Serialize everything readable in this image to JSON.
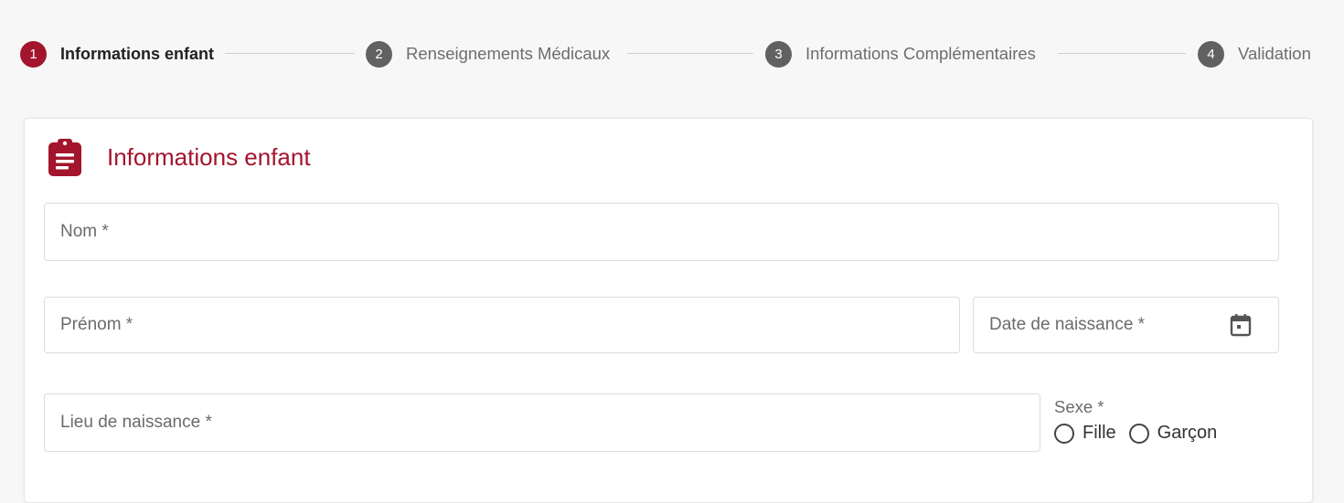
{
  "stepper": {
    "steps": [
      {
        "number": "1",
        "label": "Informations enfant",
        "active": true
      },
      {
        "number": "2",
        "label": "Renseignements Médicaux",
        "active": false
      },
      {
        "number": "3",
        "label": "Informations Complémentaires",
        "active": false
      },
      {
        "number": "4",
        "label": "Validation",
        "active": false
      }
    ]
  },
  "form": {
    "title": "Informations enfant",
    "icon": "clipboard-icon",
    "fields": {
      "nom": {
        "label": "Nom *",
        "value": ""
      },
      "prenom": {
        "label": "Prénom *",
        "value": ""
      },
      "date_naissance": {
        "label": "Date de naissance *",
        "value": "",
        "icon": "calendar-icon"
      },
      "lieu_naissance": {
        "label": "Lieu de naissance *",
        "value": ""
      }
    },
    "sexe": {
      "label": "Sexe *",
      "options": [
        "Fille",
        "Garçon"
      ],
      "selected": ""
    }
  },
  "colors": {
    "accent": "#a3152c",
    "inactive_step": "#616161",
    "background": "#f7f7f7"
  }
}
